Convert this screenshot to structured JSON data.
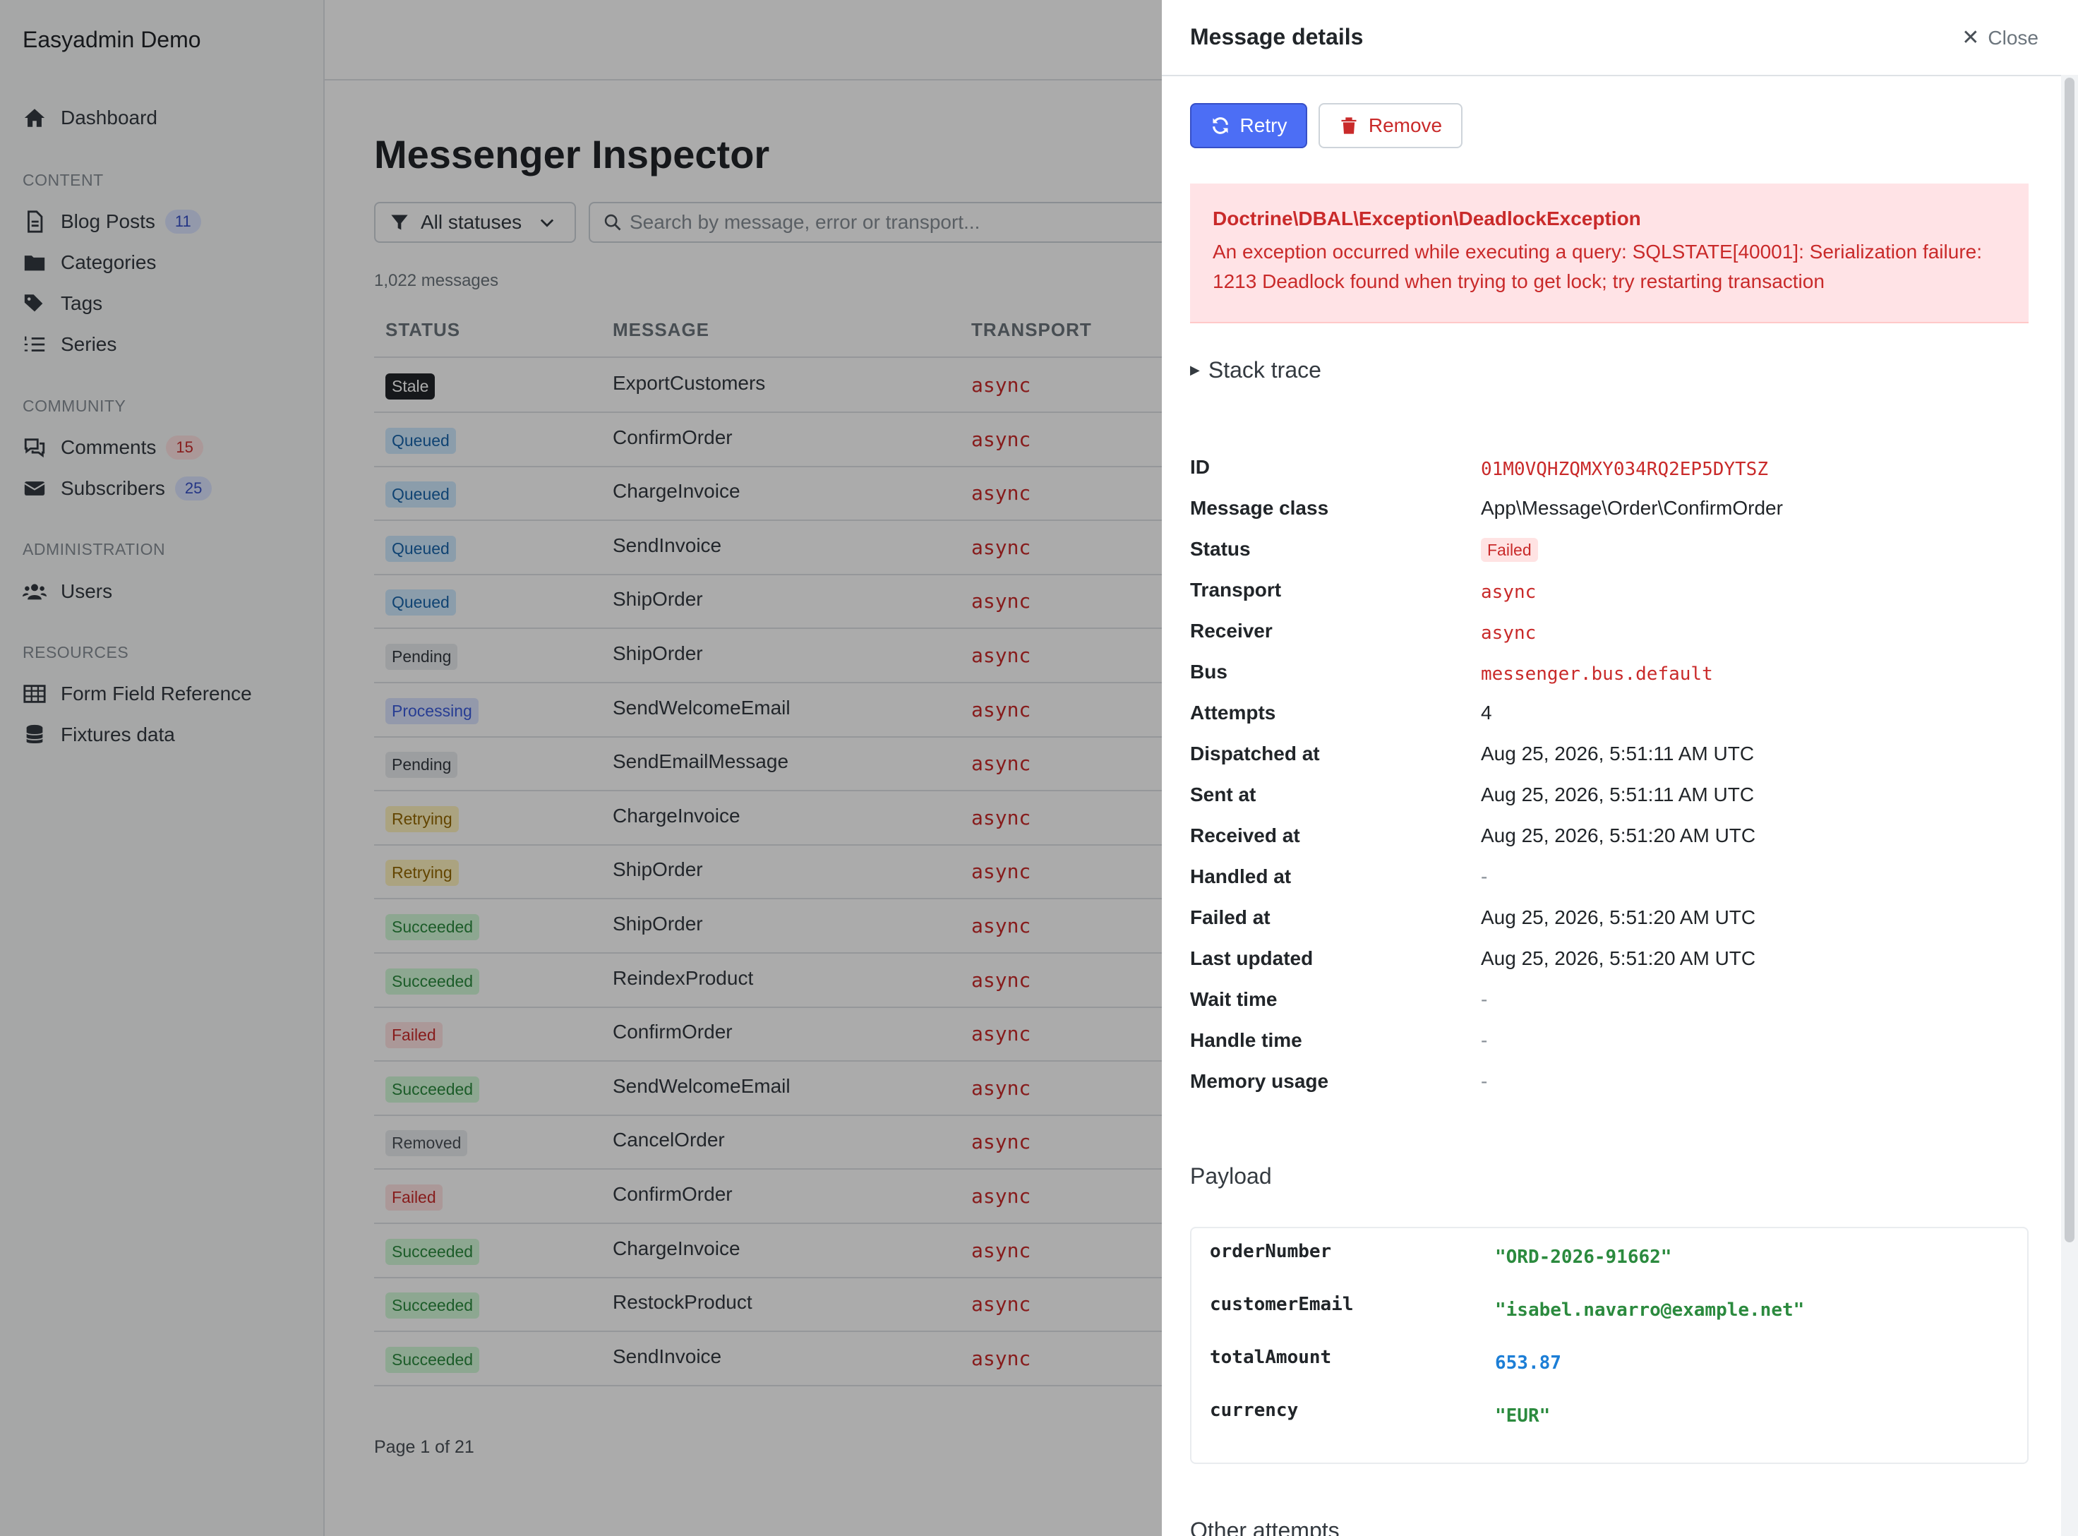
{
  "sidebar": {
    "brand": "Easyadmin Demo",
    "dashboard": "Dashboard",
    "section_content": "CONTENT",
    "blog_posts": "Blog Posts",
    "blog_posts_count": "11",
    "categories": "Categories",
    "tags": "Tags",
    "series": "Series",
    "section_community": "COMMUNITY",
    "comments": "Comments",
    "comments_count": "15",
    "subscribers": "Subscribers",
    "subscribers_count": "25",
    "section_administration": "ADMINISTRATION",
    "users": "Users",
    "section_resources": "RESOURCES",
    "form_field_reference": "Form Field Reference",
    "fixtures_data": "Fixtures data"
  },
  "main": {
    "title": "Messenger Inspector",
    "filter_label": "All statuses",
    "search_placeholder": "Search by message, error or transport...",
    "count": "1,022 messages",
    "columns": {
      "status": "STATUS",
      "message": "MESSAGE",
      "transport": "TRANSPORT"
    },
    "rows": [
      {
        "status": "Stale",
        "message": "ExportCustomers",
        "transport": "async"
      },
      {
        "status": "Queued",
        "message": "ConfirmOrder",
        "transport": "async"
      },
      {
        "status": "Queued",
        "message": "ChargeInvoice",
        "transport": "async"
      },
      {
        "status": "Queued",
        "message": "SendInvoice",
        "transport": "async"
      },
      {
        "status": "Queued",
        "message": "ShipOrder",
        "transport": "async"
      },
      {
        "status": "Pending",
        "message": "ShipOrder",
        "transport": "async"
      },
      {
        "status": "Processing",
        "message": "SendWelcomeEmail",
        "transport": "async"
      },
      {
        "status": "Pending",
        "message": "SendEmailMessage",
        "transport": "async"
      },
      {
        "status": "Retrying",
        "message": "ChargeInvoice",
        "transport": "async"
      },
      {
        "status": "Retrying",
        "message": "ShipOrder",
        "transport": "async"
      },
      {
        "status": "Succeeded",
        "message": "ShipOrder",
        "transport": "async"
      },
      {
        "status": "Succeeded",
        "message": "ReindexProduct",
        "transport": "async"
      },
      {
        "status": "Failed",
        "message": "ConfirmOrder",
        "transport": "async"
      },
      {
        "status": "Succeeded",
        "message": "SendWelcomeEmail",
        "transport": "async"
      },
      {
        "status": "Removed",
        "message": "CancelOrder",
        "transport": "async"
      },
      {
        "status": "Failed",
        "message": "ConfirmOrder",
        "transport": "async"
      },
      {
        "status": "Succeeded",
        "message": "ChargeInvoice",
        "transport": "async"
      },
      {
        "status": "Succeeded",
        "message": "RestockProduct",
        "transport": "async"
      },
      {
        "status": "Succeeded",
        "message": "SendInvoice",
        "transport": "async"
      }
    ],
    "pager": "Page 1 of 21"
  },
  "panel": {
    "title": "Message details",
    "close_label": "Close",
    "retry_label": "Retry",
    "remove_label": "Remove",
    "error_title": "Doctrine\\DBAL\\Exception\\DeadlockException",
    "error_message": "An exception occurred while executing a query: SQLSTATE[40001]: Serialization failure: 1213 Deadlock found when trying to get lock; try restarting transaction",
    "stack_trace_label": "Stack trace",
    "details": {
      "id_label": "ID",
      "id": "01M0VQHZQMXY034RQ2EP5DYTSZ",
      "class_label": "Message class",
      "class": "App\\Message\\Order\\ConfirmOrder",
      "status_label": "Status",
      "status": "Failed",
      "transport_label": "Transport",
      "transport": "async",
      "receiver_label": "Receiver",
      "receiver": "async",
      "bus_label": "Bus",
      "bus": "messenger.bus.default",
      "attempts_label": "Attempts",
      "attempts": "4",
      "dispatched_label": "Dispatched at",
      "dispatched": "Aug 25, 2026, 5:51:11 AM UTC",
      "sent_label": "Sent at",
      "sent": "Aug 25, 2026, 5:51:11 AM UTC",
      "received_label": "Received at",
      "received": "Aug 25, 2026, 5:51:20 AM UTC",
      "handled_label": "Handled at",
      "handled": "-",
      "failed_label": "Failed at",
      "failed": "Aug 25, 2026, 5:51:20 AM UTC",
      "updated_label": "Last updated",
      "updated": "Aug 25, 2026, 5:51:20 AM UTC",
      "wait_label": "Wait time",
      "wait": "-",
      "handle_label": "Handle time",
      "handle": "-",
      "memory_label": "Memory usage",
      "memory": "-"
    },
    "payload_title": "Payload",
    "payload": [
      {
        "key": "orderNumber",
        "value": "\"ORD-2026-91662\"",
        "kind": "str"
      },
      {
        "key": "customerEmail",
        "value": "\"isabel.navarro@example.net\"",
        "kind": "str"
      },
      {
        "key": "totalAmount",
        "value": "653.87",
        "kind": "num"
      },
      {
        "key": "currency",
        "value": "\"EUR\"",
        "kind": "str"
      }
    ],
    "other_attempts_title": "Other attempts"
  }
}
